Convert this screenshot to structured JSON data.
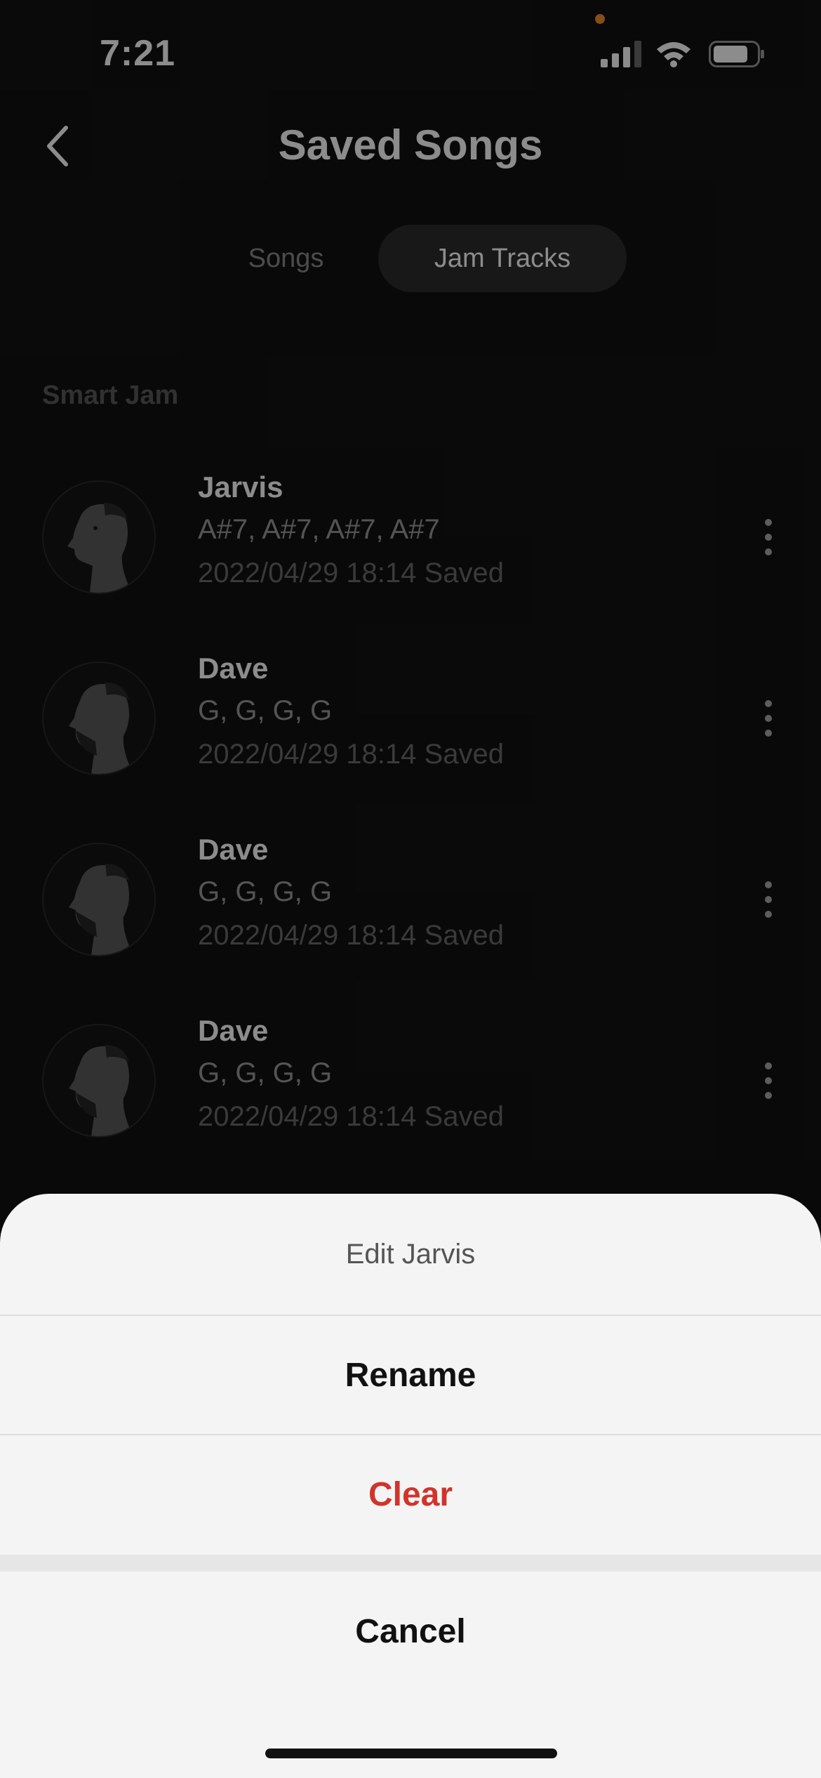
{
  "status_bar": {
    "time": "7:21"
  },
  "header": {
    "title": "Saved Songs"
  },
  "tabs": [
    {
      "label": "Songs",
      "active": false
    },
    {
      "label": "Jam Tracks",
      "active": true
    }
  ],
  "section": {
    "label": "Smart Jam"
  },
  "tracks": [
    {
      "name": "Jarvis",
      "chords": "A#7, A#7, A#7, A#7",
      "saved": "2022/04/29 18:14 Saved"
    },
    {
      "name": "Dave",
      "chords": "G, G, G, G",
      "saved": "2022/04/29 18:14 Saved"
    },
    {
      "name": "Dave",
      "chords": "G, G, G, G",
      "saved": "2022/04/29 18:14 Saved"
    },
    {
      "name": "Dave",
      "chords": "G, G, G, G",
      "saved": "2022/04/29 18:14 Saved"
    }
  ],
  "action_sheet": {
    "title": "Edit Jarvis",
    "rename_label": "Rename",
    "clear_label": "Clear",
    "cancel_label": "Cancel"
  },
  "colors": {
    "background": "#121212",
    "tab_active_bg": "#2d2d2d",
    "sheet_bg": "#f4f4f4",
    "destructive": "#d0342c",
    "accent_dot": "#f0902c"
  },
  "icons": {
    "back": "chevron-left-icon",
    "more": "more-vertical-icon",
    "signal": "cellular-signal-icon",
    "wifi": "wifi-icon",
    "battery": "battery-icon"
  }
}
